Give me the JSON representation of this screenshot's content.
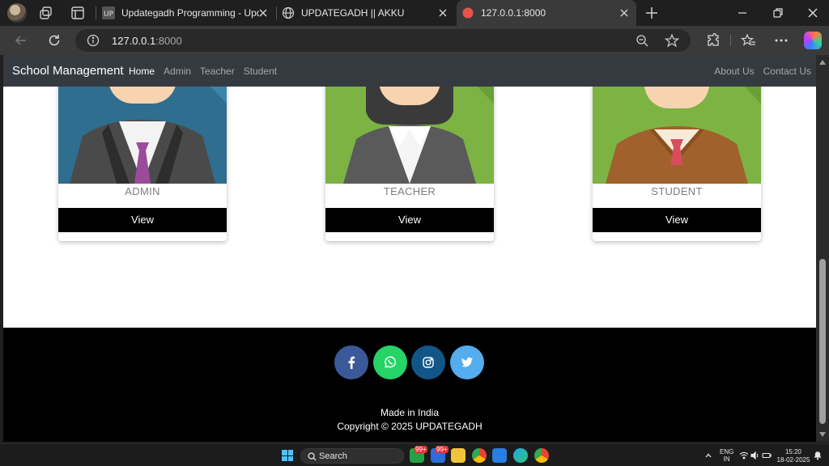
{
  "browser": {
    "tabs": [
      {
        "title": "Updategadh Programming - Upd",
        "active": false
      },
      {
        "title": "UPDATEGADH || AKKU",
        "active": false
      },
      {
        "title": "127.0.0.1:8000",
        "active": true
      }
    ],
    "url_host": "127.0.0.1",
    "url_port": ":8000"
  },
  "site": {
    "brand": "School Management",
    "nav": [
      "Home",
      "Admin",
      "Teacher",
      "Student"
    ],
    "nav_right": [
      "About Us",
      "Contact Us"
    ],
    "cards": [
      {
        "label": "ADMIN",
        "button": "View"
      },
      {
        "label": "TEACHER",
        "button": "View"
      },
      {
        "label": "STUDENT",
        "button": "View"
      }
    ],
    "footer": {
      "social": [
        {
          "icon": "facebook-icon",
          "color": "#3b5998"
        },
        {
          "icon": "whatsapp-icon",
          "color": "#25d366"
        },
        {
          "icon": "instagram-icon",
          "color": "#125688"
        },
        {
          "icon": "twitter-icon",
          "color": "#55acee"
        }
      ],
      "made_in": "Made in India",
      "copyright": "Copyright © 2025 UPDATEGADH"
    }
  },
  "taskbar": {
    "search_label": "Search",
    "badge_1": "99+",
    "badge_2": "99+",
    "lang_line1": "ENG",
    "lang_line2": "IN",
    "time": "15:20",
    "date": "18-02-2025"
  }
}
